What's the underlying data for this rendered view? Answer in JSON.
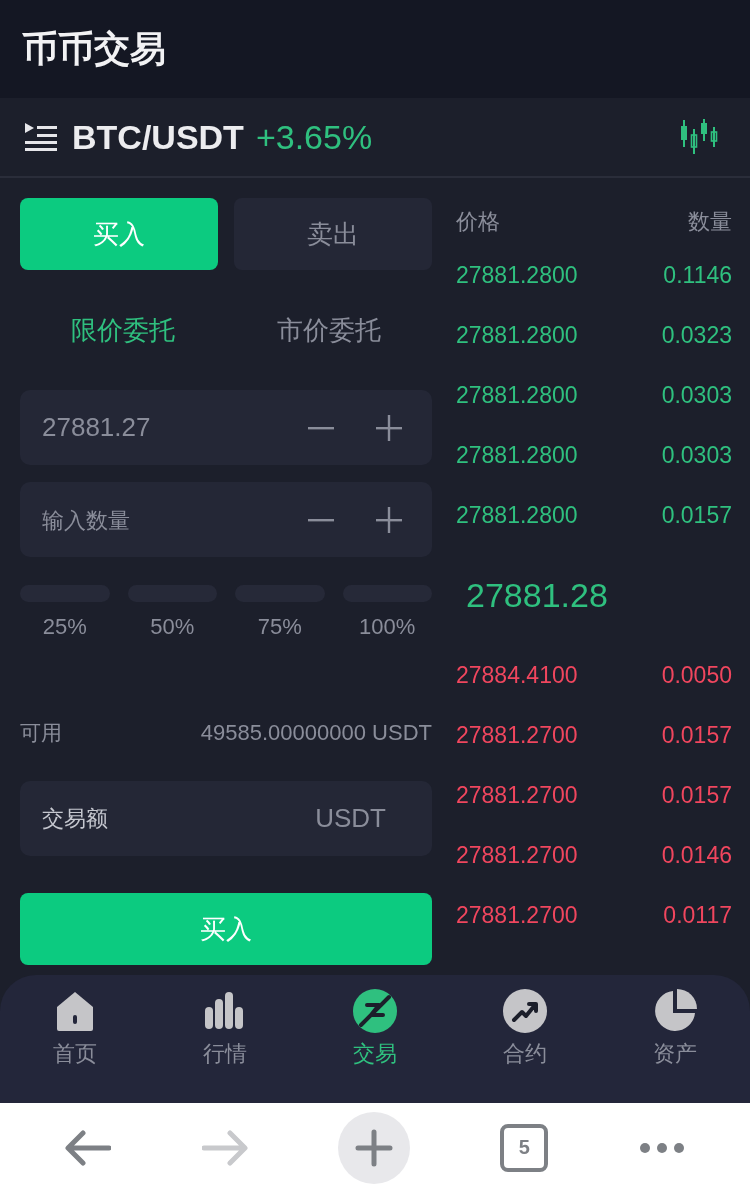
{
  "title": "币币交易",
  "pair": {
    "symbol": "BTC/USDT",
    "change": "+3.65%"
  },
  "side_tabs": [
    {
      "label": "买入",
      "selected": true
    },
    {
      "label": "卖出",
      "selected": false
    }
  ],
  "order_types": [
    {
      "label": "限价委托",
      "selected": true
    },
    {
      "label": "市价委托",
      "selected": false
    }
  ],
  "price_field": {
    "value": "27881.27"
  },
  "amount_field": {
    "placeholder": "输入数量"
  },
  "percent_options": [
    {
      "label": "25%"
    },
    {
      "label": "50%"
    },
    {
      "label": "75%"
    },
    {
      "label": "100%"
    }
  ],
  "available": {
    "label": "可用",
    "value": "49585.00000000 USDT"
  },
  "total_field": {
    "label": "交易额",
    "unit": "USDT"
  },
  "submit_button": "买入",
  "orderbook": {
    "columns": [
      "价格",
      "数量"
    ],
    "upper_rows": [
      {
        "price": "27881.2800",
        "amount": "0.1146"
      },
      {
        "price": "27881.2800",
        "amount": "0.0323"
      },
      {
        "price": "27881.2800",
        "amount": "0.0303"
      },
      {
        "price": "27881.2800",
        "amount": "0.0303"
      },
      {
        "price": "27881.2800",
        "amount": "0.0157"
      }
    ],
    "last_price": "27881.28",
    "lower_rows": [
      {
        "price": "27884.4100",
        "amount": "0.0050"
      },
      {
        "price": "27881.2700",
        "amount": "0.0157"
      },
      {
        "price": "27881.2700",
        "amount": "0.0157"
      },
      {
        "price": "27881.2700",
        "amount": "0.0146"
      },
      {
        "price": "27881.2700",
        "amount": "0.0117"
      }
    ]
  },
  "nav": [
    {
      "kind": "home",
      "label": "首页",
      "selected": false
    },
    {
      "kind": "market",
      "label": "行情",
      "selected": false
    },
    {
      "kind": "trade",
      "label": "交易",
      "selected": true
    },
    {
      "kind": "contract",
      "label": "合约",
      "selected": false
    },
    {
      "kind": "assets",
      "label": "资产",
      "selected": false
    }
  ],
  "browser_toolbar": {
    "buttons": [
      {
        "kind": "back",
        "disabled": false
      },
      {
        "kind": "forward",
        "disabled": true
      },
      {
        "kind": "new-tab",
        "disabled": false
      },
      {
        "kind": "tabs",
        "disabled": false
      },
      {
        "kind": "more",
        "disabled": false
      }
    ],
    "tab_count": "5"
  }
}
